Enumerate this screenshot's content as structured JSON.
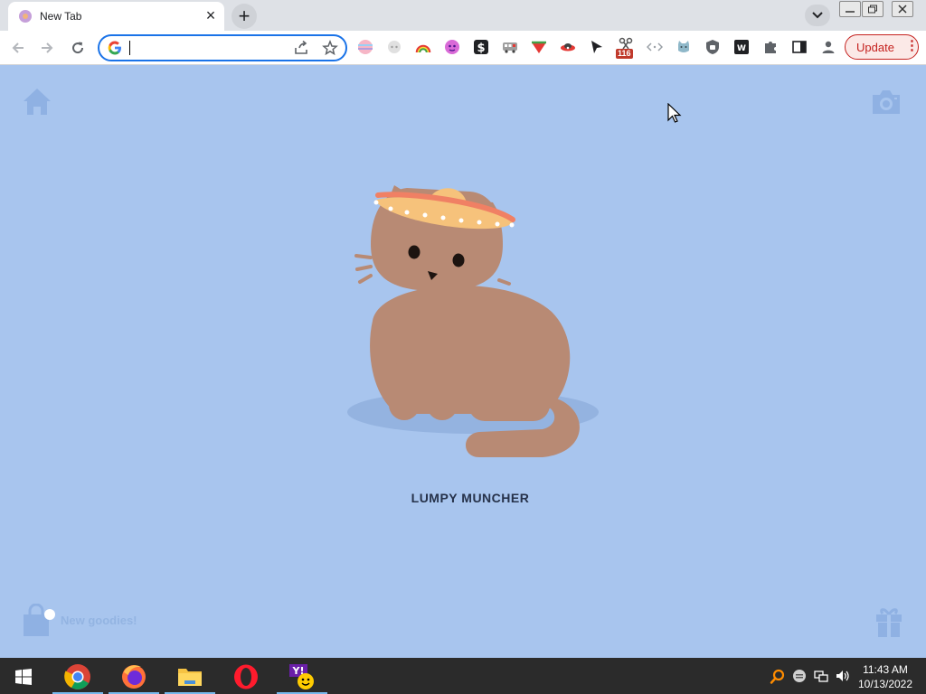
{
  "browser": {
    "tab": {
      "title": "New Tab",
      "close_glyph": "×"
    },
    "new_tab_glyph": "+",
    "omnibox": {
      "value": ""
    },
    "update": {
      "label": "Update",
      "menu_glyph": "⋮"
    },
    "extensions": [
      "rainbow-ext-icon",
      "pale-ext-icon",
      "rainbow-arc-ext-icon",
      "pink-ext-icon",
      "dollar-ext-icon",
      "bus-ext-icon",
      "watermelon-ext-icon",
      "ufo-ext-icon",
      "cursor-ext-icon",
      "scissors-ext-icon",
      "code-ext-icon",
      "cat-ext-icon",
      "shield-ext-icon",
      "ublock-ext-icon",
      "wh-ext-icon",
      "puzzle-ext-icon",
      "sidepanel-icon",
      "profile-icon"
    ],
    "extension_badge": "116"
  },
  "page": {
    "cat_name": "LUMPY MUNCHER",
    "goodies_label": "New goodies!"
  },
  "taskbar": {
    "apps": [
      "chrome-icon",
      "firefox-icon",
      "file-explorer-icon",
      "opera-icon",
      "yahoo-messenger-icon"
    ],
    "clock": {
      "time": "11:43 AM",
      "date": "10/13/2022"
    }
  },
  "colors": {
    "page_background": "#a8c5ee",
    "cat": "#b88a74",
    "accent": "#1a73e8",
    "update": "#c5221f"
  }
}
